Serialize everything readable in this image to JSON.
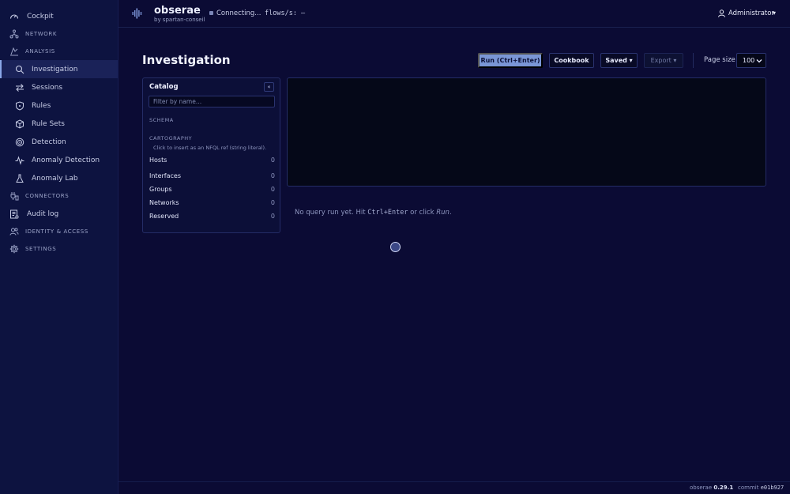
{
  "brand": {
    "name": "obserae",
    "subtitle": "by spartan-conseil"
  },
  "status": {
    "connection": "Connecting...",
    "flows": "flows/s: —"
  },
  "user": {
    "name": "Administrator",
    "caret": "▾"
  },
  "sidebar": {
    "cockpit": "Cockpit",
    "network": "NETWORK",
    "analysis": "ANALYSIS",
    "items": [
      {
        "label": "Investigation",
        "icon": "search-icon"
      },
      {
        "label": "Sessions",
        "icon": "swap-arrows-icon"
      },
      {
        "label": "Rules",
        "icon": "shield-icon"
      },
      {
        "label": "Rule Sets",
        "icon": "cube-icon"
      },
      {
        "label": "Detection",
        "icon": "target-icon"
      },
      {
        "label": "Anomaly Detection",
        "icon": "pulse-icon"
      },
      {
        "label": "Anomaly Lab",
        "icon": "flask-icon"
      }
    ],
    "connectors": "CONNECTORS",
    "audit_log": "Audit log",
    "identity": "IDENTITY & ACCESS",
    "settings": "SETTINGS"
  },
  "page": {
    "title": "Investigation"
  },
  "toolbar": {
    "run": "Run (Ctrl+Enter)",
    "cookbook": "Cookbook",
    "saved": "Saved ▾",
    "export": "Export ▾",
    "page_size_label": "Page size",
    "page_size_value": "100"
  },
  "catalog": {
    "title": "Catalog",
    "collapse": "«",
    "filter_placeholder": "Filter by name…",
    "schema_label": "SCHEMA",
    "cartography_label": "CARTOGRAPHY",
    "hint": "Click to insert as an NFQL ref (string literal).",
    "rows": [
      {
        "name": "Hosts",
        "count": "0"
      },
      {
        "name": "Interfaces",
        "count": "0"
      },
      {
        "name": "Groups",
        "count": "0"
      },
      {
        "name": "Networks",
        "count": "0"
      },
      {
        "name": "Reserved",
        "count": "0"
      }
    ]
  },
  "results": {
    "empty_prefix": "No query run yet. Hit ",
    "shortcut": "Ctrl+Enter",
    "empty_mid": " or click ",
    "run_word": "Run",
    "empty_suffix": "."
  },
  "footer": {
    "app": "obserae",
    "version": "0.29.1",
    "commit_label": "commit",
    "commit": "e01b927"
  }
}
